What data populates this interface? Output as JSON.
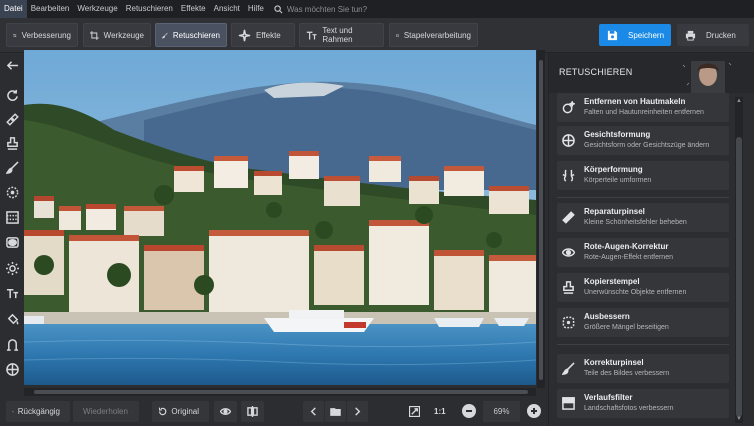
{
  "menu": {
    "items": [
      "Datei",
      "Bearbeiten",
      "Werkzeuge",
      "Retuschieren",
      "Effekte",
      "Ansicht",
      "Hilfe"
    ],
    "search_placeholder": "Was möchten Sie tun?"
  },
  "toolbar": {
    "tabs": [
      {
        "label": "Verbesserung",
        "icon": "sliders-icon"
      },
      {
        "label": "Werkzeuge",
        "icon": "crop-icon"
      },
      {
        "label": "Retuschieren",
        "icon": "brush-icon",
        "active": true
      },
      {
        "label": "Effekte",
        "icon": "sparkle-icon"
      },
      {
        "label": "Text und Rahmen",
        "icon": "text-icon"
      },
      {
        "label": "Stapelverarbeitung",
        "icon": "images-icon"
      }
    ],
    "save_label": "Speichern",
    "print_label": "Drucken"
  },
  "left_rail": {
    "icons": [
      "back-arrow-icon",
      "rotate-icon",
      "healing-icon",
      "stamp-icon",
      "brush-icon",
      "radial-icon",
      "gradient-icon",
      "vignette-icon",
      "light-icon",
      "text-icon",
      "fill-icon",
      "warp-icon",
      "globe-icon"
    ]
  },
  "bottombar": {
    "undo_label": "Rückgängig",
    "redo_label": "Wiederholen",
    "original_label": "Original",
    "fit_label": "1:1",
    "zoom_value": "69%"
  },
  "panel": {
    "title": "RETUSCHIEREN",
    "tools": [
      {
        "name": "Entfernen von Hautmakeln",
        "desc": "Falten und Hautunreinheiten entfernen",
        "icon": "face-sparkle-icon"
      },
      {
        "name": "Gesichtsformung",
        "desc": "Gesichtsform oder Gesichtszüge ändern",
        "icon": "face-shape-icon"
      },
      {
        "name": "Körperformung",
        "desc": "Körperteile umformen",
        "icon": "body-shape-icon"
      },
      {
        "name": "Reparaturpinsel",
        "desc": "Kleine Schönheitsfehler beheben",
        "icon": "bandage-icon"
      },
      {
        "name": "Rote-Augen-Korrektur",
        "desc": "Rote-Augen-Effekt entfernen",
        "icon": "eye-icon"
      },
      {
        "name": "Kopierstempel",
        "desc": "Unerwünschte Objekte entfernen",
        "icon": "stamp-icon"
      },
      {
        "name": "Ausbessern",
        "desc": "Größere Mängel beseitigen",
        "icon": "patch-icon"
      },
      {
        "name": "Korrekturpinsel",
        "desc": "Teile des Bildes verbessern",
        "icon": "brush-icon"
      },
      {
        "name": "Verlaufsfilter",
        "desc": "Landschaftsfotos verbessern",
        "icon": "gradient-filter-icon"
      }
    ]
  }
}
